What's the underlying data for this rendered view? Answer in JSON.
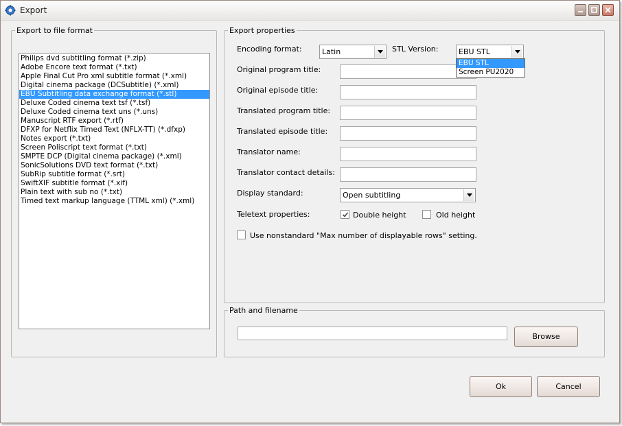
{
  "window": {
    "title": "Export"
  },
  "format_group": {
    "legend": "Export to file format",
    "items": [
      "Philips dvd subtitling format (*.zip)",
      "Adobe Encore text format (*.txt)",
      "Apple Final Cut Pro xml subtitle format (*.xml)",
      "Digital cinema package (DCSubtitle) (*.xml)",
      "EBU Subtitling data exchange format (*.stl)",
      "Deluxe Coded cinema text tsf (*.tsf)",
      "Deluxe Coded cinema text uns (*.uns)",
      "Manuscript RTF export (*.rtf)",
      "DFXP for Netflix Timed Text (NFLX-TT) (*.dfxp)",
      "Notes export (*.txt)",
      "Screen Poliscript text format (*.txt)",
      "SMPTE DCP (Digital cinema package) (*.xml)",
      "SonicSolutions DVD text format (*.txt)",
      "SubRip subtitle format (*.srt)",
      "SwiftXIF subtitle format (*.xif)",
      "Plain text with sub no (*.txt)",
      "Timed text markup language (TTML xml) (*.xml)"
    ],
    "selected_index": 4
  },
  "props": {
    "legend": "Export properties",
    "encoding_label": "Encoding format:",
    "encoding_value": "Latin",
    "stl_label": "STL Version:",
    "stl_value": "EBU STL",
    "stl_options": [
      "EBU STL",
      "Screen PU2020"
    ],
    "original_program_title_label": "Original program title:",
    "original_episode_title_label": "Original episode title:",
    "translated_program_title_label": "Translated program title:",
    "translated_episode_title_label": "Translated episode title:",
    "translator_name_label": "Translator name:",
    "translator_contact_label": "Translator contact details:",
    "display_standard_label": "Display standard:",
    "display_standard_value": "Open subtitling",
    "teletext_label": "Teletext properties:",
    "double_height_label": "Double height",
    "double_height_checked": true,
    "old_height_label": "Old height",
    "old_height_checked": false,
    "nonstandard_label": "Use nonstandard \"Max number of displayable rows\" setting.",
    "nonstandard_checked": false
  },
  "path_group": {
    "legend": "Path and filename",
    "path_value": "",
    "browse_label": "Browse"
  },
  "buttons": {
    "ok": "Ok",
    "cancel": "Cancel"
  }
}
